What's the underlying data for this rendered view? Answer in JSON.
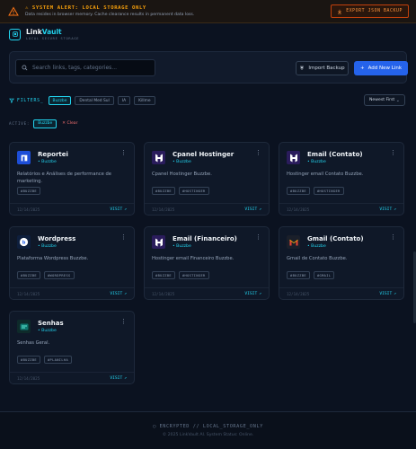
{
  "alert": {
    "title": "⚠ SYSTEM ALERT: LOCAL STORAGE ONLY",
    "subtitle": "Data resides in browser memory. Cache clearance results in permanent data loss.",
    "export_label": "EXPORT JSON BACKUP"
  },
  "header": {
    "brand_main": "Link",
    "brand_accent": "Vault",
    "subtitle": "LOCAL SECURE STORAGE"
  },
  "search": {
    "placeholder": "Search links, tags, categories...",
    "value": "",
    "import_label": "Import Backup",
    "add_label": "Add New Link"
  },
  "filters": {
    "label": "FILTERS_",
    "chips": [
      "Buzzbe",
      "Dental Med Sul",
      "IA",
      "Killme"
    ],
    "selected": "Buzzbe",
    "sort_label": "Newest First"
  },
  "active_filter": {
    "label": "ACTIVE:",
    "value": "Buzzbe",
    "clear_label": "✕ Clear"
  },
  "cards": [
    {
      "title": "Reportei",
      "category": "Buzzbe",
      "description": "Relatórios e Análises de performance de marketing.",
      "tags": [
        "#BUZZBE"
      ],
      "date": "12/14/2025",
      "visit": "VISIT",
      "icon": "reportei-icon",
      "color": "#1d4ed8"
    },
    {
      "title": "Cpanel Hostinger",
      "category": "Buzzbe",
      "description": "Cpanel Hostinger Buzzbe.",
      "tags": [
        "#BUZZBE",
        "#HOSTINGER"
      ],
      "date": "12/14/2025",
      "visit": "VISIT",
      "icon": "hostinger-icon",
      "color": "#673de6"
    },
    {
      "title": "Email (Contato)",
      "category": "Buzzbe",
      "description": "Hostinger email Contato Buzzbe.",
      "tags": [
        "#BUZZBE",
        "#HOSTINGER"
      ],
      "date": "12/14/2025",
      "visit": "VISIT",
      "icon": "hostinger-icon",
      "color": "#673de6"
    },
    {
      "title": "Wordpress",
      "category": "Buzzbe",
      "description": "Plataforma Wordpress Buzzbe.",
      "tags": [
        "#BUZZBE",
        "#WORDPRESS"
      ],
      "date": "12/14/2025",
      "visit": "VISIT",
      "icon": "buzzbe-icon",
      "color": "#2563eb"
    },
    {
      "title": "Email (Financeiro)",
      "category": "Buzzbe",
      "description": "Hostinger email Financeiro Buzzbe.",
      "tags": [
        "#BUZZBE",
        "#HOSTINGER"
      ],
      "date": "12/14/2025",
      "visit": "VISIT",
      "icon": "hostinger-icon",
      "color": "#673de6"
    },
    {
      "title": "Gmail (Contato)",
      "category": "Buzzbe",
      "description": "Gmail de Contato Buzzbe.",
      "tags": [
        "#BUZZBE",
        "#GMAIL"
      ],
      "date": "12/14/2025",
      "visit": "VISIT",
      "icon": "gmail-icon",
      "color": "#ea4335"
    },
    {
      "title": "Senhas",
      "category": "Buzzbe",
      "description": "Senhas Geral.",
      "tags": [
        "#BUZZBE",
        "#PLANILHA"
      ],
      "date": "12/14/2025",
      "visit": "VISIT",
      "icon": "sheet-icon",
      "color": "#0f766e"
    }
  ],
  "footer": {
    "line1": "ENCRYPTED // LOCAL_STORAGE_ONLY",
    "line2": "© 2025 LinkVault AI. System Status: Online."
  }
}
